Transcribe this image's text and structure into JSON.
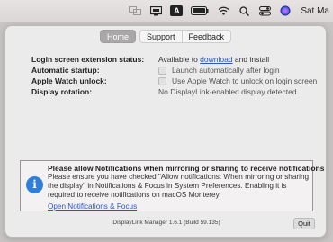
{
  "menubar": {
    "icons": [
      "displaylink-icon",
      "display-icon",
      "font-icon",
      "battery-icon",
      "wifi-icon",
      "search-icon",
      "control-center-icon",
      "siri-icon"
    ],
    "font_icon_label": "A",
    "time": "Sat Ma"
  },
  "tabs": {
    "home": "Home",
    "support": "Support",
    "feedback": "Feedback"
  },
  "rows": {
    "login_label": "Login screen extension status:",
    "login_prefix": "Available to ",
    "login_link": "download",
    "login_suffix": " and install",
    "startup_label": "Automatic startup:",
    "startup_value": "Launch automatically after login",
    "watch_label": "Apple Watch unlock:",
    "watch_value": "Use Apple Watch to unlock on login screen",
    "display_label": "Display rotation:",
    "display_value": "No DisplayLink-enabled display detected"
  },
  "notice": {
    "title": "Please allow Notifications when mirroring or sharing to receive notifications",
    "body": "Please ensure you have checked \"Allow notifications: When mirroring or sharing the display\" in Notifications & Focus in System Preferences. Enabling it is required to receive notifications on macOS Monterey.",
    "link": "Open Notifications & Focus",
    "icon": "info-icon"
  },
  "footer": {
    "version": "DisplayLink Manager 1.6.1 (Build 59.135)",
    "quit": "Quit"
  }
}
